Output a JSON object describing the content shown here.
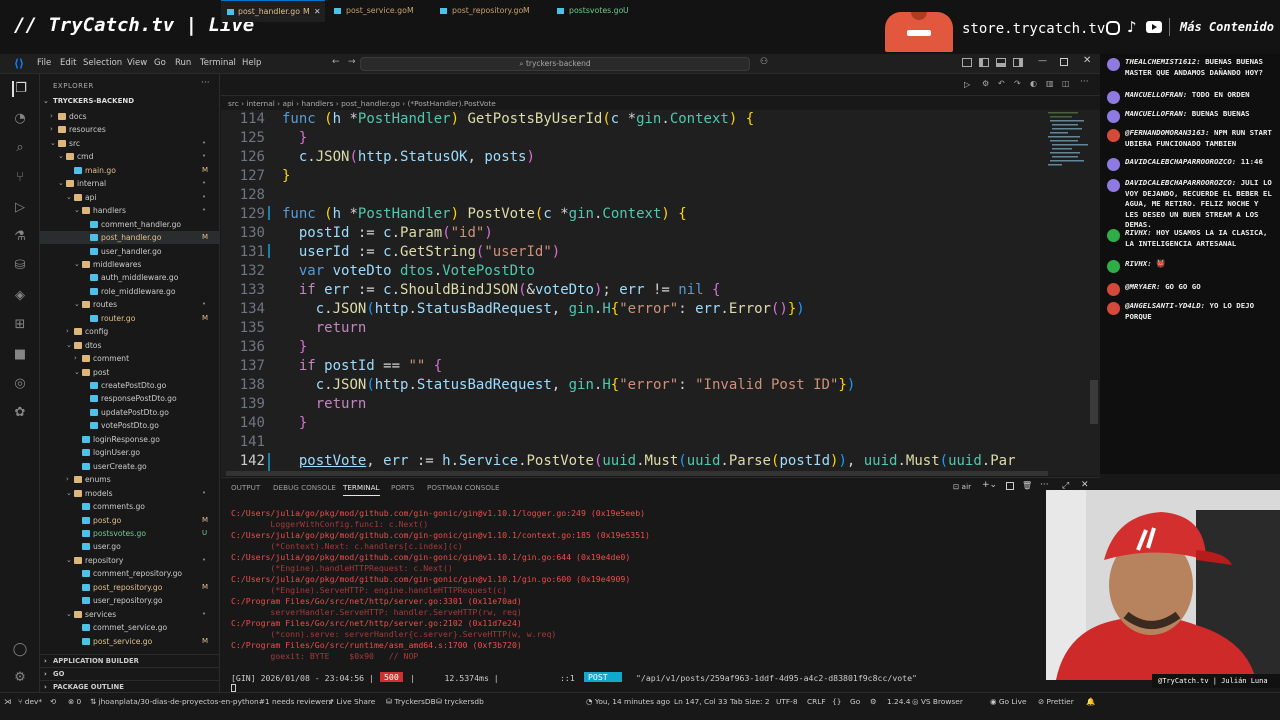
{
  "stream": {
    "brand": "// TryCatch.tv | Live",
    "store": "store.trycatch.tv",
    "more_content": "Más Contenido",
    "cam_label": "@TryCatch.tv | Julián Luna"
  },
  "titlebar": {
    "menu": [
      "File",
      "Edit",
      "Selection",
      "View",
      "Go",
      "Run",
      "Terminal",
      "Help"
    ],
    "search": "tryckers-backend"
  },
  "explorer": {
    "title": "EXPLORER",
    "root": "TRYCKERS-BACKEND",
    "items": [
      {
        "label": "docs",
        "kind": "folder",
        "badge": ""
      },
      {
        "label": "resources",
        "kind": "folder",
        "badge": ""
      },
      {
        "label": "src",
        "kind": "folder-open",
        "badge": "•"
      },
      {
        "label": "cmd",
        "kind": "folder-open",
        "badge": "•"
      },
      {
        "label": "main.go",
        "kind": "go",
        "badge": "M"
      },
      {
        "label": "internal",
        "kind": "folder-open",
        "badge": "•"
      },
      {
        "label": "api",
        "kind": "folder-open",
        "badge": "•"
      },
      {
        "label": "handlers",
        "kind": "folder-open",
        "badge": "•"
      },
      {
        "label": "comment_handler.go",
        "kind": "go",
        "badge": ""
      },
      {
        "label": "post_handler.go",
        "kind": "go",
        "badge": "M"
      },
      {
        "label": "user_handler.go",
        "kind": "go",
        "badge": ""
      },
      {
        "label": "middlewares",
        "kind": "folder-open",
        "badge": ""
      },
      {
        "label": "auth_middleware.go",
        "kind": "go",
        "badge": ""
      },
      {
        "label": "role_middleware.go",
        "kind": "go",
        "badge": ""
      },
      {
        "label": "routes",
        "kind": "folder-open",
        "badge": "•"
      },
      {
        "label": "router.go",
        "kind": "go",
        "badge": "M"
      },
      {
        "label": "config",
        "kind": "folder",
        "badge": ""
      },
      {
        "label": "dtos",
        "kind": "folder-open",
        "badge": ""
      },
      {
        "label": "comment",
        "kind": "folder",
        "badge": ""
      },
      {
        "label": "post",
        "kind": "folder-open",
        "badge": ""
      },
      {
        "label": "createPostDto.go",
        "kind": "go",
        "badge": ""
      },
      {
        "label": "responsePostDto.go",
        "kind": "go",
        "badge": ""
      },
      {
        "label": "updatePostDto.go",
        "kind": "go",
        "badge": ""
      },
      {
        "label": "votePostDto.go",
        "kind": "go",
        "badge": ""
      },
      {
        "label": "loginResponse.go",
        "kind": "go",
        "badge": ""
      },
      {
        "label": "loginUser.go",
        "kind": "go",
        "badge": ""
      },
      {
        "label": "userCreate.go",
        "kind": "go",
        "badge": ""
      },
      {
        "label": "enums",
        "kind": "folder",
        "badge": ""
      },
      {
        "label": "models",
        "kind": "folder-open",
        "badge": "•"
      },
      {
        "label": "comments.go",
        "kind": "go",
        "badge": ""
      },
      {
        "label": "post.go",
        "kind": "go",
        "badge": "M"
      },
      {
        "label": "postsvotes.go",
        "kind": "go",
        "badge": "U"
      },
      {
        "label": "user.go",
        "kind": "go",
        "badge": ""
      },
      {
        "label": "repository",
        "kind": "folder-open",
        "badge": "•"
      },
      {
        "label": "comment_repository.go",
        "kind": "go",
        "badge": ""
      },
      {
        "label": "post_repository.go",
        "kind": "go",
        "badge": "M"
      },
      {
        "label": "user_repository.go",
        "kind": "go",
        "badge": ""
      },
      {
        "label": "services",
        "kind": "folder-open",
        "badge": "•"
      },
      {
        "label": "commet_service.go",
        "kind": "go",
        "badge": ""
      },
      {
        "label": "post_service.go",
        "kind": "go",
        "badge": "M"
      }
    ],
    "sections": [
      "APPLICATION BUILDER",
      "GO",
      "PACKAGE OUTLINE"
    ]
  },
  "tabs": [
    {
      "label": "post_handler.go",
      "badge": "M",
      "active": true
    },
    {
      "label": "post_service.go",
      "badge": "M",
      "active": false
    },
    {
      "label": "post_repository.go",
      "badge": "M",
      "active": false
    },
    {
      "label": "postsvotes.go",
      "badge": "U",
      "active": false
    }
  ],
  "breadcrumb": "src › internal › api › handlers › post_handler.go › (*PostHandler).PostVote",
  "editor": {
    "line_numbers": [
      "114",
      "125",
      "126",
      "127",
      "128",
      "129",
      "130",
      "131",
      "132",
      "133",
      "134",
      "135",
      "136",
      "137",
      "138",
      "139",
      "140",
      "141",
      "142"
    ]
  },
  "panel": {
    "tabs": [
      "OUTPUT",
      "DEBUG CONSOLE",
      "TERMINAL",
      "PORTS",
      "POSTMAN CONSOLE"
    ],
    "shell": "air",
    "lines": [
      "C:/Users/julia/go/pkg/mod/github.com/gin-gonic/gin@v1.10.1/logger.go:249 (0x19e5eeb)",
      "        LoggerWithConfig.func1: c.Next()",
      "C:/Users/julia/go/pkg/mod/github.com/gin-gonic/gin@v1.10.1/context.go:185 (0x19e5351)",
      "        (*Context).Next: c.handlers[c.index](c)",
      "C:/Users/julia/go/pkg/mod/github.com/gin-gonic/gin@v1.10.1/gin.go:644 (0x19e4de0)",
      "        (*Engine).handleHTTPRequest: c.Next()",
      "C:/Users/julia/go/pkg/mod/github.com/gin-gonic/gin@v1.10.1/gin.go:600 (0x19e4909)",
      "        (*Engine).ServeHTTP: engine.handleHTTPRequest(c)",
      "C:/Program Files/Go/src/net/http/server.go:3301 (0x11e70ad)",
      "        serverHandler.ServeHTTP: handler.ServeHTTP(rw, req)",
      "C:/Program Files/Go/src/net/http/server.go:2102 (0x11d7e24)",
      "        (*conn).serve: serverHandler{c.server}.ServeHTTP(w, w.req)",
      "C:/Program Files/Go/src/runtime/asm_amd64.s:1700 (0xf3b720)",
      "        goexit: BYTE    $0x90   // NOP"
    ],
    "gin_prefix": "[GIN] 2026/01/08 - 23:04:56 |",
    "gin_status": "500",
    "gin_mid": "|      12.5374ms |",
    "gin_ip": "::1",
    "gin_method": "POST",
    "gin_path": "\"/api/v1/posts/259af963-1ddf-4d95-a4c2-d83801f9c8cc/vote\""
  },
  "status": {
    "branch": "dev*",
    "ports": "0",
    "commit_msg": "jhoanplata/30-dias-de-proyectos-en-python#1 needs reviewers",
    "liveshare": "Live Share",
    "db1": "TryckersDB",
    "db2": "tryckersdb",
    "time": "You, 14 minutes ago",
    "position": "Ln 147, Col 33",
    "tab": "Tab Size: 2",
    "encoding": "UTF-8",
    "eol": "CRLF",
    "lang": "Go",
    "version": "1.24.4",
    "vsb": "VS Browser",
    "golive": "Go Live",
    "prettier": "Prettier"
  },
  "chat": [
    {
      "user": "THEALCHEMIST1612:",
      "text": "BUENAS BUENAS MASTER QUE ANDAMOS DAÑANDO HOY?",
      "color": "#8e7ae0"
    },
    {
      "user": "MANCUELLOFRAN:",
      "text": "TODO EN ORDEN",
      "color": "#8e7ae0"
    },
    {
      "user": "MANCUELLOFRAN:",
      "text": "BUENAS BUENAS",
      "color": "#8e7ae0"
    },
    {
      "user": "@FERNANDOMORAN3163:",
      "text": "NPM RUN START UBIERA FUNCIONADO TAMBIEN",
      "color": "#d44a3a"
    },
    {
      "user": "DAVIDCALEBCHAPARROOROZCO:",
      "text": "11:46",
      "color": "#8e7ae0"
    },
    {
      "user": "DAVIDCALEBCHAPARROOROZCO:",
      "text": "JULI LO VOY DEJANDO, RECUERDE EL BEBER EL AGUA, ME RETIRO. FELIZ NOCHE Y LES DESEO UN BUEN STREAM A LOS DEMAS.",
      "color": "#8e7ae0"
    },
    {
      "user": "RIVHX:",
      "text": "HOY USAMOS LA IA CLASICA, LA INTELIGENCIA ARTESANAL",
      "color": "#2fae48"
    },
    {
      "user": "RIVHX:",
      "text": "👹",
      "color": "#2fae48"
    },
    {
      "user": "@MRYAER:",
      "text": "GO GO GO",
      "color": "#d44a3a"
    },
    {
      "user": "@ANGELSANTI-YD4LD:",
      "text": "YO LO DEJO PORQUE",
      "color": "#d44a3a"
    }
  ]
}
